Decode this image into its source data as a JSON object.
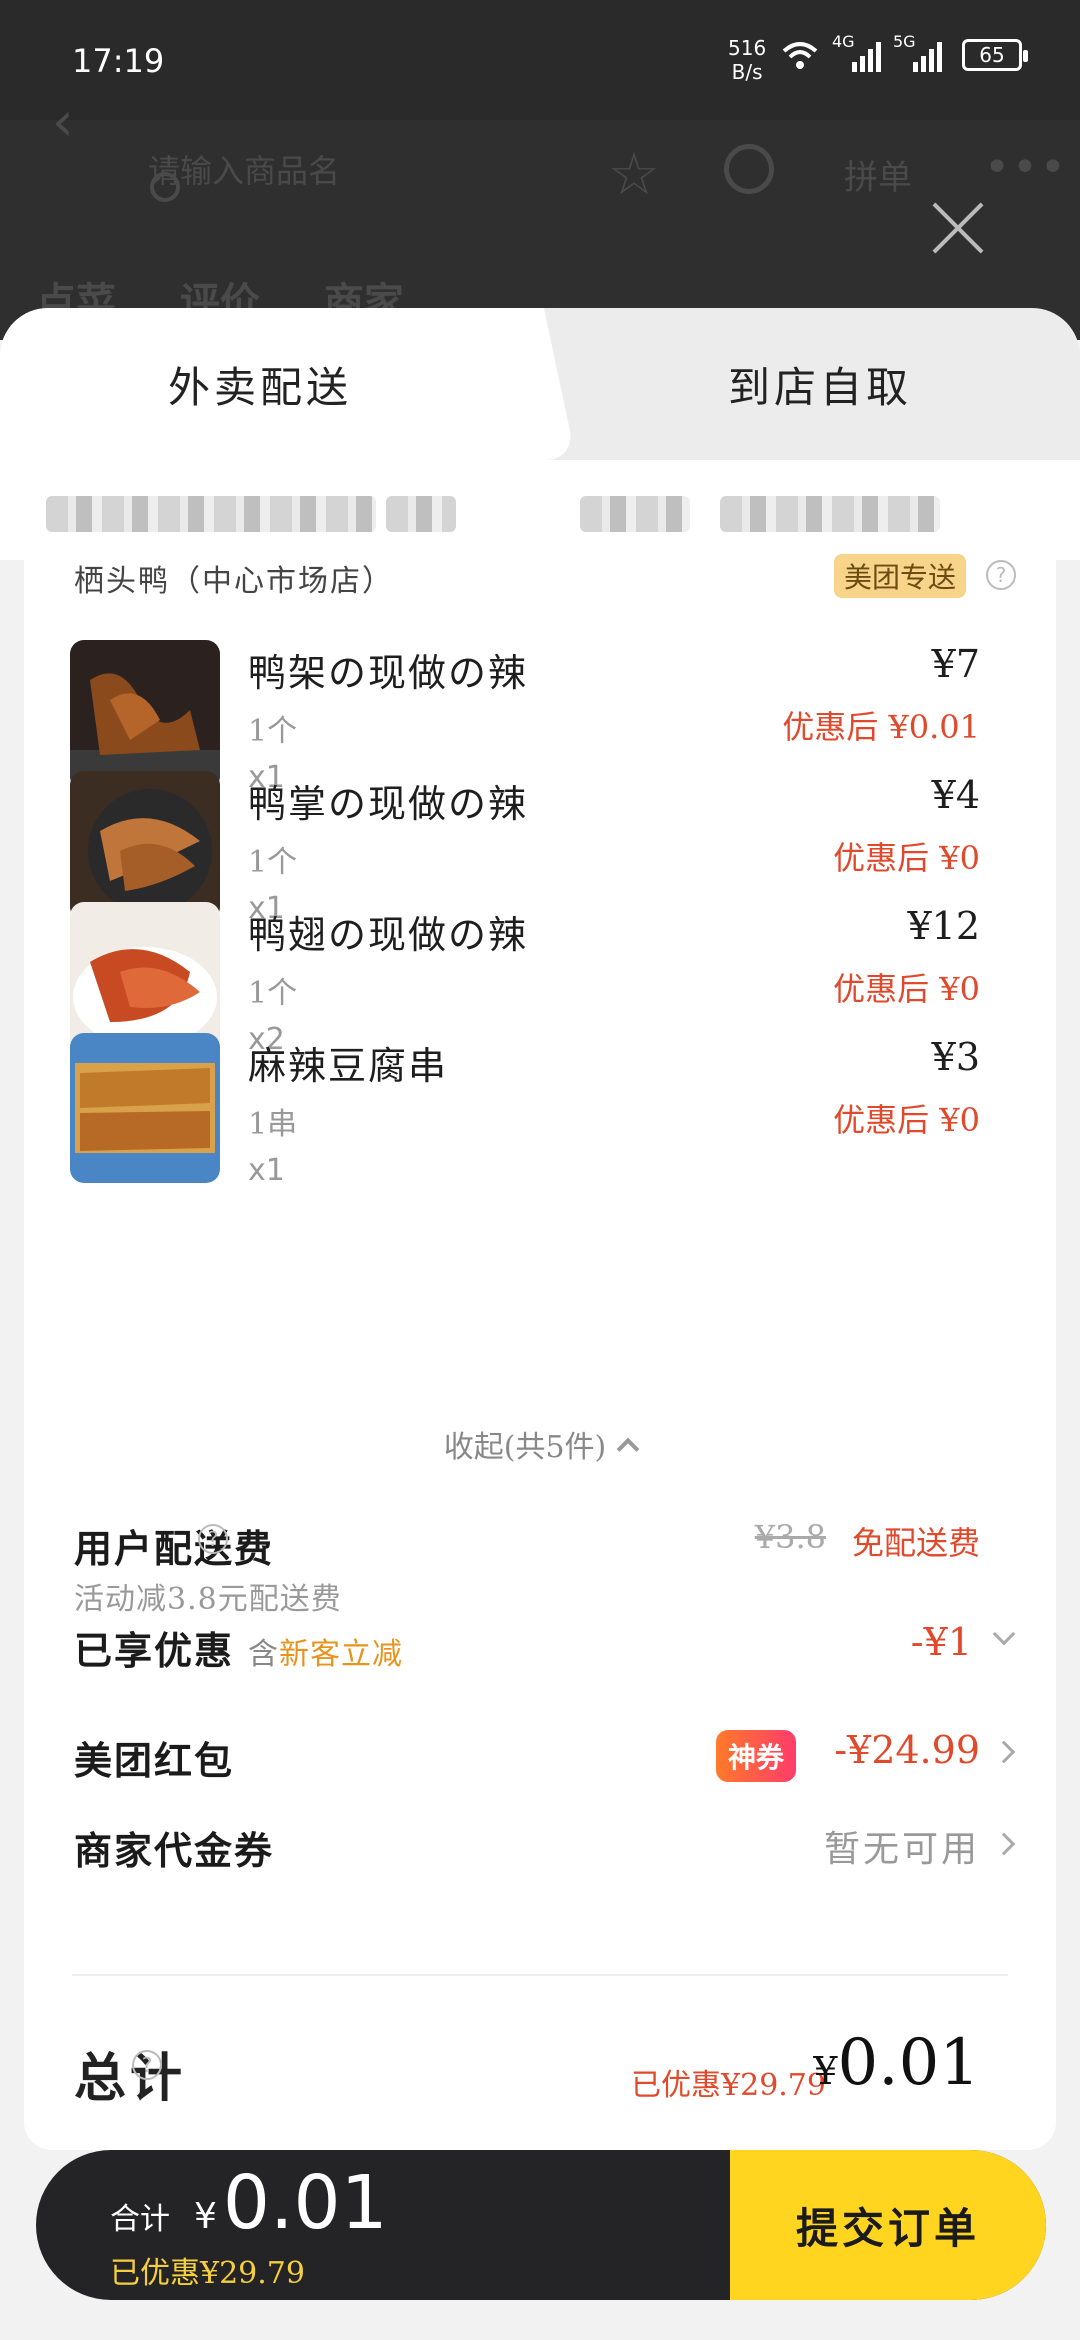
{
  "status": {
    "time": "17:19",
    "net_speed_value": "516",
    "net_speed_unit": "B/s",
    "net4g": "4G",
    "net5g": "5G",
    "battery": "65"
  },
  "header": {
    "search_placeholder": "请输入商品名",
    "pindan": "拼单",
    "more": "•••",
    "tabs": "点菜 评价 商家"
  },
  "delivery_tabs": {
    "active": "外卖配送",
    "inactive": "到店自取"
  },
  "shop": {
    "name": "栖头鸭（中心市场店）",
    "badge": "美团专送"
  },
  "items": [
    {
      "name": "鸭架の现做の辣",
      "spec": "1个",
      "qty": "x1",
      "price": "¥7",
      "discount": "优惠后 ¥0.01"
    },
    {
      "name": "鸭掌の现做の辣",
      "spec": "1个",
      "qty": "x1",
      "price": "¥4",
      "discount": "优惠后 ¥0"
    },
    {
      "name": "鸭翅の现做の辣",
      "spec": "1个",
      "qty": "x2",
      "price": "¥12",
      "discount": "优惠后 ¥0"
    },
    {
      "name": "麻辣豆腐串",
      "spec": "1串",
      "qty": "x1",
      "price": "¥3",
      "discount": "优惠后 ¥0"
    }
  ],
  "collapse_label": "收起(共5件)",
  "delivery_fee": {
    "title": "用户配送费",
    "sub": "活动减3.8元配送费",
    "original": "¥3.8",
    "value": "免配送费"
  },
  "discounts": {
    "title": "已享优惠",
    "han": "含",
    "detail": "新客立减",
    "value": "-¥1"
  },
  "redpacket": {
    "title": "美团红包",
    "tag": "神券",
    "value": "-¥24.99"
  },
  "voucher": {
    "title": "商家代金券",
    "value": "暂无可用"
  },
  "total": {
    "title": "总计",
    "saved": "已优惠¥29.79",
    "currency": "¥",
    "amount": "0.01"
  },
  "bottom": {
    "sum_label": "合计",
    "currency": "¥",
    "sum_amount": "0.01",
    "saved": "已优惠¥29.79",
    "submit": "提交订单"
  },
  "colors": {
    "accent_red": "#e0492b",
    "submit_yellow": "#ffd51f",
    "bar_dark": "#242426"
  }
}
